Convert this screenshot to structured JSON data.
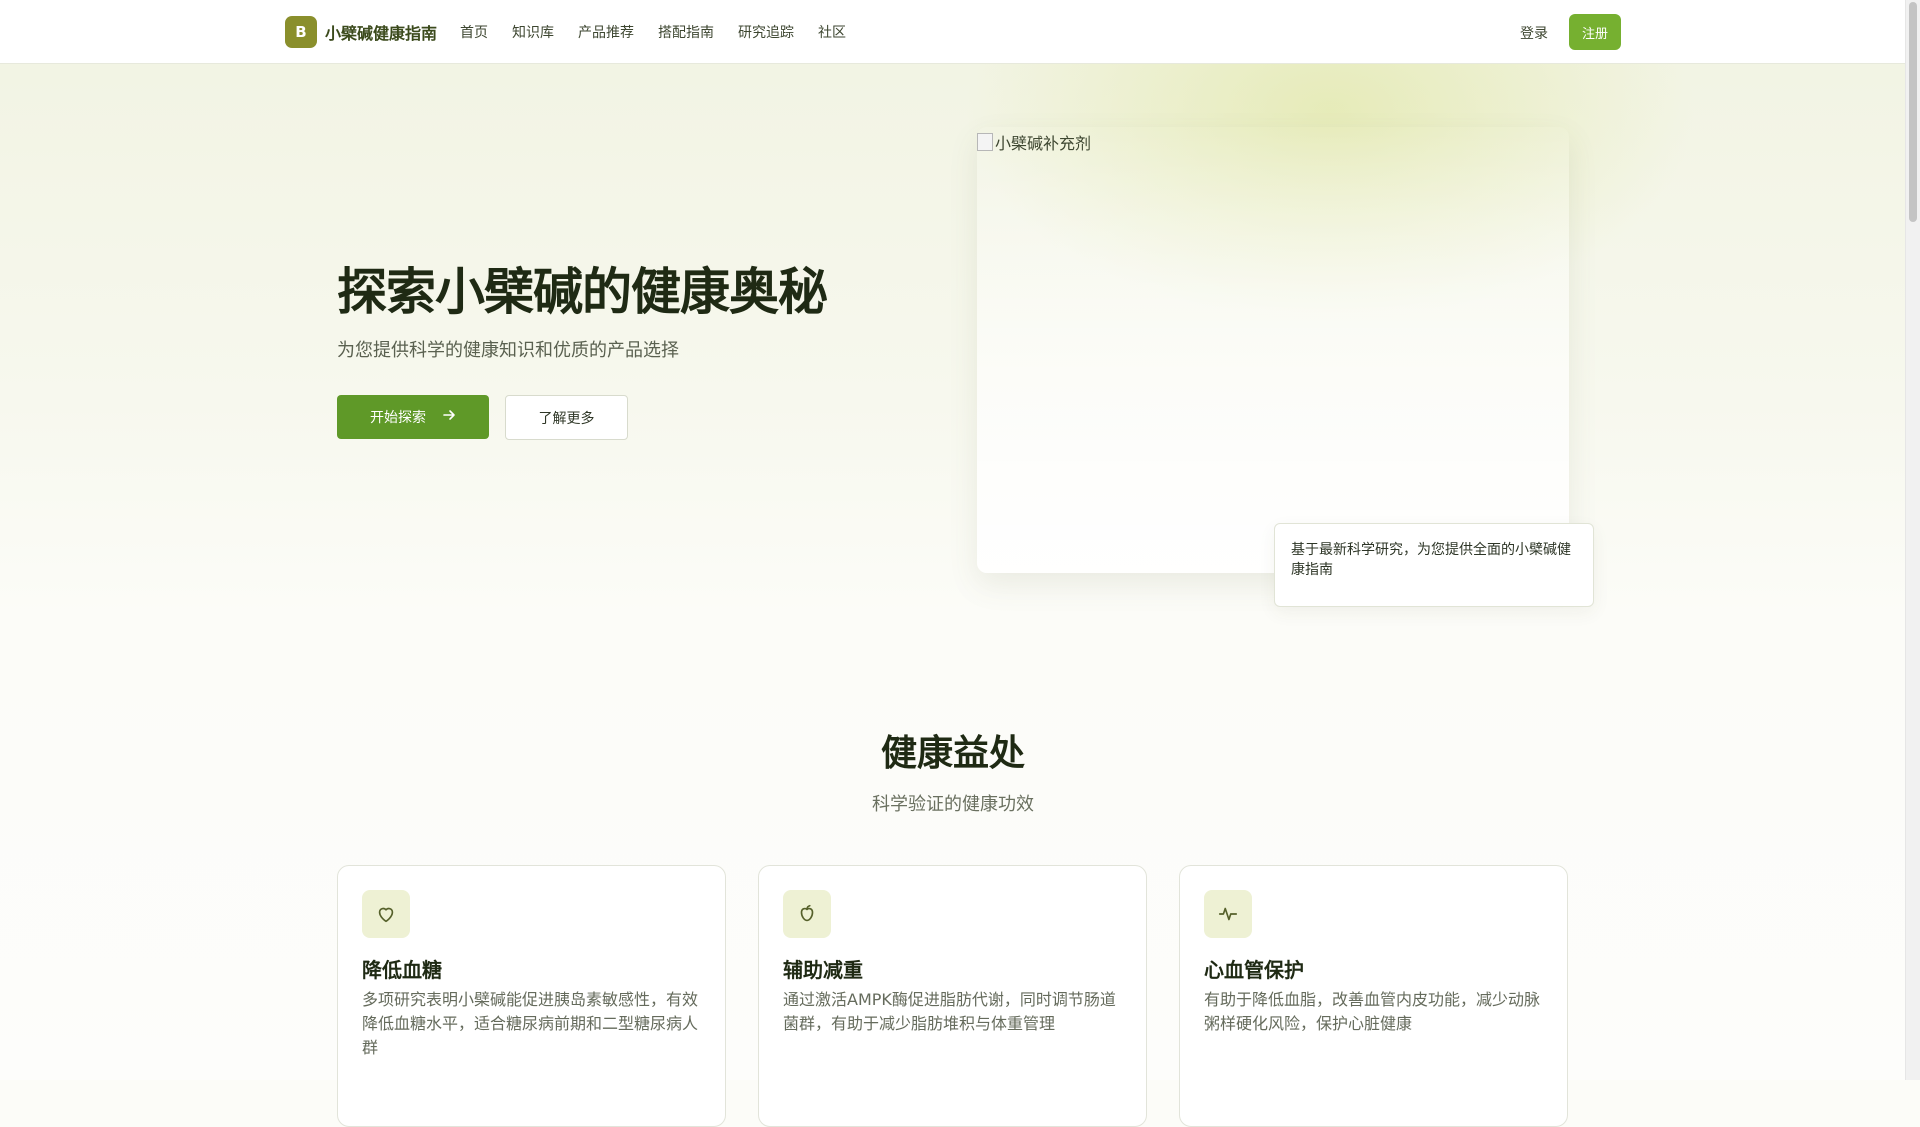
{
  "header": {
    "logo_letter": "B",
    "brand_name": "小檗碱健康指南",
    "nav": [
      "首页",
      "知识库",
      "产品推荐",
      "搭配指南",
      "研究追踪",
      "社区"
    ],
    "login_label": "登录",
    "signup_label": "注册"
  },
  "hero": {
    "title": "探索小檗碱的健康奥秘",
    "subtitle": "为您提供科学的健康知识和优质的产品选择",
    "primary_button": "开始探索",
    "secondary_button": "了解更多",
    "image_alt": "小檗碱补充剂",
    "note": "基于最新科学研究，为您提供全面的小檗碱健康指南"
  },
  "benefits": {
    "title": "健康益处",
    "subtitle": "科学验证的健康功效",
    "cards": [
      {
        "icon": "heart-icon",
        "title": "降低血糖",
        "desc": "多项研究表明小檗碱能促进胰岛素敏感性，有效降低血糖水平，适合糖尿病前期和二型糖尿病人群"
      },
      {
        "icon": "apple-icon",
        "title": "辅助减重",
        "desc": "通过激活AMPK酶促进脂肪代谢，同时调节肠道菌群，有助于减少脂肪堆积与体重管理"
      },
      {
        "icon": "activity-icon",
        "title": "心血管保护",
        "desc": "有助于降低血脂，改善血管内皮功能，减少动脉粥样硬化风险，保护心脏健康"
      }
    ]
  },
  "colors": {
    "brand": "#8a8f2c",
    "primary_button": "#5f9928",
    "signup_button": "#76b030",
    "icon_bg": "#eef1d4"
  }
}
